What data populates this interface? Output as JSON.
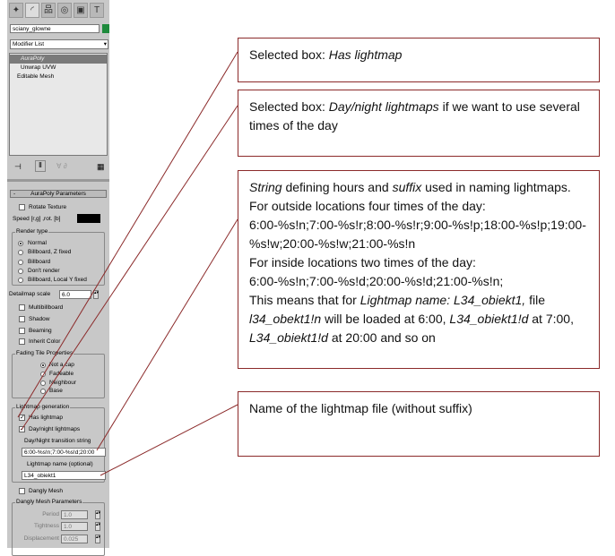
{
  "panel": {
    "toolbar_icons": [
      "create-icon",
      "modify-icon",
      "hierarchy-icon",
      "motion-icon",
      "display-icon",
      "utilities-icon"
    ],
    "object_name": "sciany_glowne",
    "object_color": "#1e8a3c",
    "modifier_list": "Modifier List",
    "stack": [
      "AuraPoly",
      "Unwrap UVW",
      "Editable Mesh"
    ],
    "rollout_title": "AuraPoly Parameters",
    "rollout_toggle": "-",
    "rotate_texture": "Rotate Texture",
    "speed_label": "Speed [r,g] ,rot. [b]",
    "render_type": {
      "label": "Render type",
      "options": [
        "Normal",
        "Billboard, Z fixed",
        "Billboard",
        "Don't render",
        "Billboard, Local Y fixed"
      ],
      "selected": 0
    },
    "detailmap_label": "Detailmap scale",
    "detailmap_value": "6.0",
    "checks": [
      "Multibillboard",
      "Shadow",
      "Beaming",
      "Inherit Color"
    ],
    "fading": {
      "label": "Fading Tile Properties",
      "options": [
        "Not a cap",
        "Fadeable",
        "Neighbour",
        "Base"
      ],
      "selected": 0
    },
    "lightmap": {
      "label": "Lightmap generation",
      "has_lightmap": "Has lightmap",
      "day_night": "Day/night lightmaps",
      "transition_label": "Day/Night transition string",
      "transition_value": "6:00-%s!n;7:00-%s!d;20:00",
      "name_label": "Lightmap name (optional)",
      "name_value": "L34_obiekt1"
    },
    "dangly_mesh": "Dangly Mesh",
    "dangly": {
      "label": "Dangly Mesh Parameters",
      "period_label": "Period",
      "period": "1.0",
      "tightness_label": "Tightness",
      "tightness": "1.0",
      "displacement_label": "Displacement",
      "displacement": "0.025"
    }
  },
  "callouts": {
    "c1": {
      "prefix": "Selected box: ",
      "em": "Has lightmap"
    },
    "c2": {
      "prefix": "Selected box: ",
      "em": "Day/night lightmaps",
      "suffix": " if we want to use several times of the day"
    },
    "c3": {
      "em1": "String",
      "t1": " defining hours and ",
      "em2": "suffix",
      "t2": " used in naming lightmaps.",
      "l2": "For outside locations four times of the day:",
      "l3": "6:00-%s!n;7:00-%s!r;8:00-%s!r;9:00-%s!p;18:00-%s!p;19:00-%s!w;20:00-%s!w;21:00-%s!n",
      "l4": "For inside locations two times of the day:",
      "l5": "6:00-%s!n;7:00-%s!d;20:00-%s!d;21:00-%s!n;",
      "t3": "This means that for ",
      "em3": "Lightmap name: L34_obiekt1,",
      "t4": " file ",
      "em4": "l34_obekt1!n",
      "t5": " will be loaded at 6:00, ",
      "em5": "L34_obiekt1!d",
      "t6": " at 7:00, ",
      "em6": "L34_obiekt1!d",
      "t7": " at 20:00 and so on"
    },
    "c4": {
      "text": "Name of the lightmap file (without suffix)"
    },
    "line_color": "#8b2a2a"
  }
}
